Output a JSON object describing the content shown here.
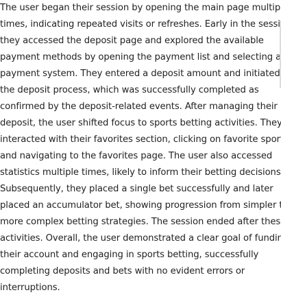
{
  "summary": {
    "lines": [
      "The user began their session by opening the main page multiple",
      "times, indicating repeated visits or refreshes. Early in the session,",
      "they accessed the deposit page and explored the available",
      "payment methods by opening the payment list and selecting a",
      "payment system. They entered a deposit amount and initiated",
      "the deposit process, which was successfully completed as",
      "confirmed by the deposit-related events. After managing their",
      "deposit, the user shifted focus to sports betting activities. They",
      "interacted with their favorites section, clicking on favorite sports",
      "and navigating to the favorites page. The user also accessed",
      "statistics multiple times, likely to inform their betting decisions.",
      "Subsequently, they placed a single bet successfully and later",
      "placed an accumulator bet, showing progression from simpler to",
      "more complex betting strategies. The session ended after these",
      "activities. Overall, the user demonstrated a clear goal of funding",
      "their account and engaging in sports betting, successfully",
      "completing deposits and bets with no evident errors or",
      "interruptions."
    ]
  }
}
